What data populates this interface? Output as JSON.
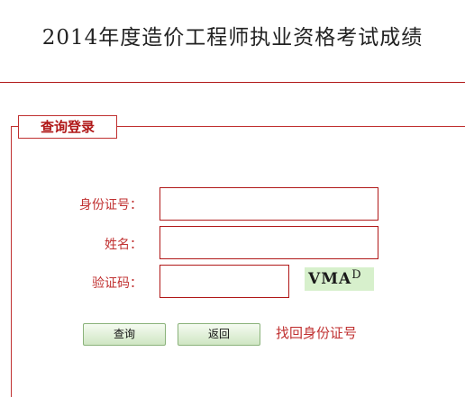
{
  "page": {
    "title": "2014年度造价工程师执业资格考试成绩"
  },
  "form": {
    "legend": "查询登录",
    "id_label": "身份证号：",
    "name_label": "姓名：",
    "captcha_label": "验证码：",
    "id_value": "",
    "name_value": "",
    "captcha_value": "",
    "captcha_text": "VMA",
    "captcha_sup": "D"
  },
  "actions": {
    "query_label": "查询",
    "back_label": "返回",
    "find_id_label": "找回身份证号"
  },
  "colors": {
    "accent": "#b01818",
    "label": "#c03030",
    "captcha_bg": "#d7f0cc",
    "button_green": "#cfe6c3"
  }
}
